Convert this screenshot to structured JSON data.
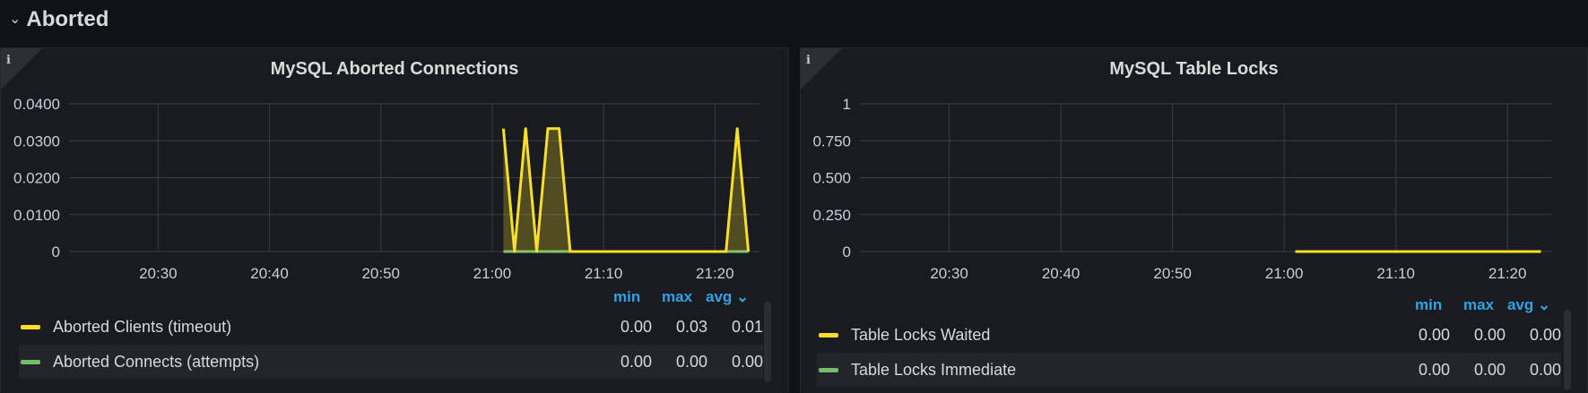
{
  "row": {
    "title": "Aborted",
    "chevron_icon": "chevron-down-icon"
  },
  "panels": [
    {
      "title": "MySQL Aborted Connections",
      "info_icon": "i",
      "legend": {
        "headers": {
          "min": "min",
          "max": "max",
          "avg": "avg"
        },
        "sort_icon": "⌄",
        "rows": [
          {
            "name": "Aborted Clients (timeout)",
            "color": "#fade2a",
            "min": "0.00",
            "max": "0.03",
            "avg": "0.01"
          },
          {
            "name": "Aborted Connects (attempts)",
            "color": "#73bf69",
            "min": "0.00",
            "max": "0.00",
            "avg": "0.00"
          }
        ]
      }
    },
    {
      "title": "MySQL Table Locks",
      "info_icon": "i",
      "legend": {
        "headers": {
          "min": "min",
          "max": "max",
          "avg": "avg"
        },
        "sort_icon": "⌄",
        "rows": [
          {
            "name": "Table Locks Waited",
            "color": "#fade2a",
            "min": "0.00",
            "max": "0.00",
            "avg": "0.00"
          },
          {
            "name": "Table Locks Immediate",
            "color": "#73bf69",
            "min": "0.00",
            "max": "0.00",
            "avg": "0.00"
          }
        ]
      }
    }
  ],
  "chart_data": [
    {
      "type": "area",
      "title": "MySQL Aborted Connections",
      "x_ticks": [
        "20:30",
        "20:40",
        "20:50",
        "21:00",
        "21:10",
        "21:20"
      ],
      "y_ticks": [
        "0",
        "0.0100",
        "0.0200",
        "0.0300",
        "0.0400"
      ],
      "ylim": [
        0,
        0.04
      ],
      "xlim": [
        "20:22",
        "21:24"
      ],
      "series": [
        {
          "name": "Aborted Clients (timeout)",
          "color": "#fade2a",
          "x": [
            "21:01",
            "21:02",
            "21:03",
            "21:04",
            "21:05",
            "21:06",
            "21:07",
            "21:08",
            "21:21",
            "21:22",
            "21:23"
          ],
          "y": [
            0.0333,
            0,
            0.0333,
            0,
            0.0333,
            0.0333,
            0,
            0,
            0,
            0.0333,
            0
          ]
        },
        {
          "name": "Aborted Connects (attempts)",
          "color": "#73bf69",
          "x": [
            "21:01",
            "21:23"
          ],
          "y": [
            0,
            0
          ]
        }
      ],
      "grid": true
    },
    {
      "type": "line",
      "title": "MySQL Table Locks",
      "x_ticks": [
        "20:30",
        "20:40",
        "20:50",
        "21:00",
        "21:10",
        "21:20"
      ],
      "y_ticks": [
        "0",
        "0.250",
        "0.500",
        "0.750",
        "1"
      ],
      "ylim": [
        0,
        1
      ],
      "xlim": [
        "20:22",
        "21:24"
      ],
      "series": [
        {
          "name": "Table Locks Waited",
          "color": "#fade2a",
          "x": [
            "21:01",
            "21:23"
          ],
          "y": [
            0,
            0
          ]
        },
        {
          "name": "Table Locks Immediate",
          "color": "#73bf69",
          "x": [
            "21:01",
            "21:23"
          ],
          "y": [
            0,
            0
          ]
        }
      ],
      "grid": true
    }
  ]
}
